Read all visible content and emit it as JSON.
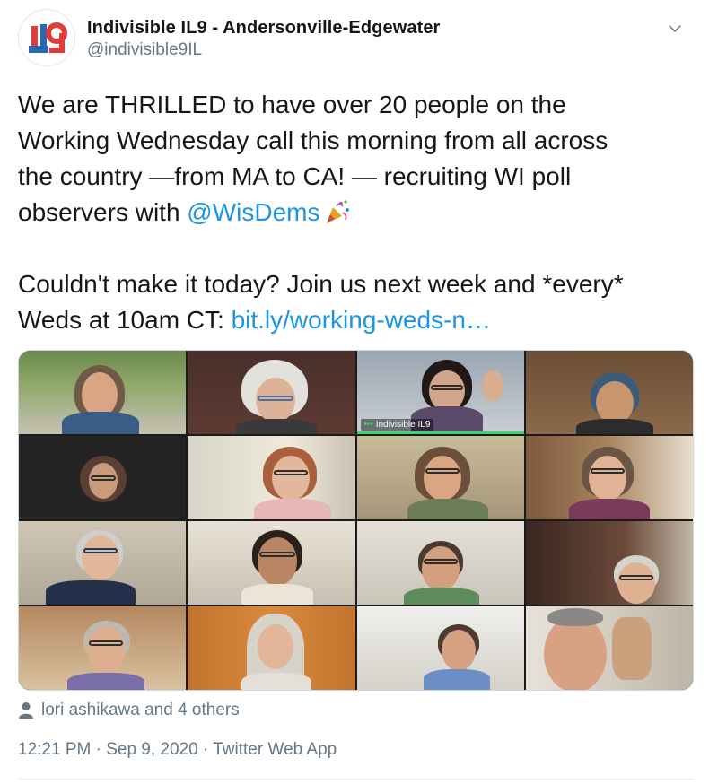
{
  "tweet": {
    "author_name": "Indivisible IL9 - Andersonville-Edgewater",
    "handle": "@indivisible9IL",
    "avatar_text": "IL9",
    "menu_icon": "chevron-down-icon",
    "text": {
      "line1": "We are THRILLED to have over 20 people on the",
      "line2": "Working Wednesday call this morning from all across",
      "line3": "the country  —from MA to CA! — recruiting WI poll",
      "line4_prefix": "observers with ",
      "mention": "@WisDems",
      "emoji": "party-popper-icon",
      "line5": "Couldn't make it today? Join us next week and *every*",
      "line6_prefix": "Weds at 10am CT: ",
      "url": "bit.ly/working-weds-n…"
    },
    "media": {
      "participant_label": "Indivisible IL9",
      "label_prefix": "•••"
    },
    "likes_text": "lori ashikawa and 4 others",
    "time": "12:21 PM",
    "separator": "·",
    "date": "Sep 9, 2020",
    "source": "Twitter Web App"
  },
  "colors": {
    "link": "#1b95e0",
    "secondary_text": "#657786",
    "primary_text": "#14171a",
    "speaker_highlight": "#3bd46b"
  }
}
